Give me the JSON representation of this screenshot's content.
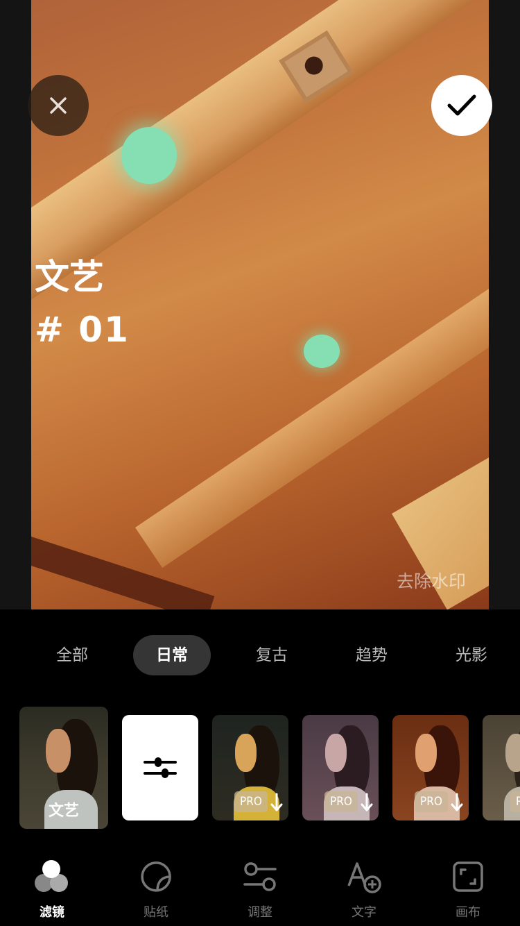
{
  "preview": {
    "title_line1": "文艺",
    "title_line2": "# 01",
    "watermark": "去除水印"
  },
  "categories": [
    {
      "label": "全部",
      "active": false
    },
    {
      "label": "日常",
      "active": true
    },
    {
      "label": "复古",
      "active": false
    },
    {
      "label": "趋势",
      "active": false
    },
    {
      "label": "光影",
      "active": false
    }
  ],
  "filters": [
    {
      "label": "文艺",
      "selected": true
    },
    {
      "icon": "sliders-icon"
    },
    {
      "badge": "PRO",
      "icon": "download-icon",
      "tint": "#2a2a20"
    },
    {
      "badge": "PRO",
      "icon": "download-icon",
      "tint": "#5a4450"
    },
    {
      "badge": "PRO",
      "icon": "download-icon",
      "tint": "#7a3a1a"
    },
    {
      "badge": "PRO",
      "icon": "download-icon",
      "tint": "#5a5040"
    }
  ],
  "nav": [
    {
      "label": "滤镜",
      "icon": "filter-icon",
      "active": true
    },
    {
      "label": "贴纸",
      "icon": "sticker-icon",
      "active": false
    },
    {
      "label": "调整",
      "icon": "adjust-icon",
      "active": false
    },
    {
      "label": "文字",
      "icon": "text-add-icon",
      "active": false
    },
    {
      "label": "画布",
      "icon": "canvas-icon",
      "active": false
    }
  ],
  "colors": {
    "background": "#000000",
    "accent_light": "#86dfb3",
    "active_pill": "#353535"
  }
}
